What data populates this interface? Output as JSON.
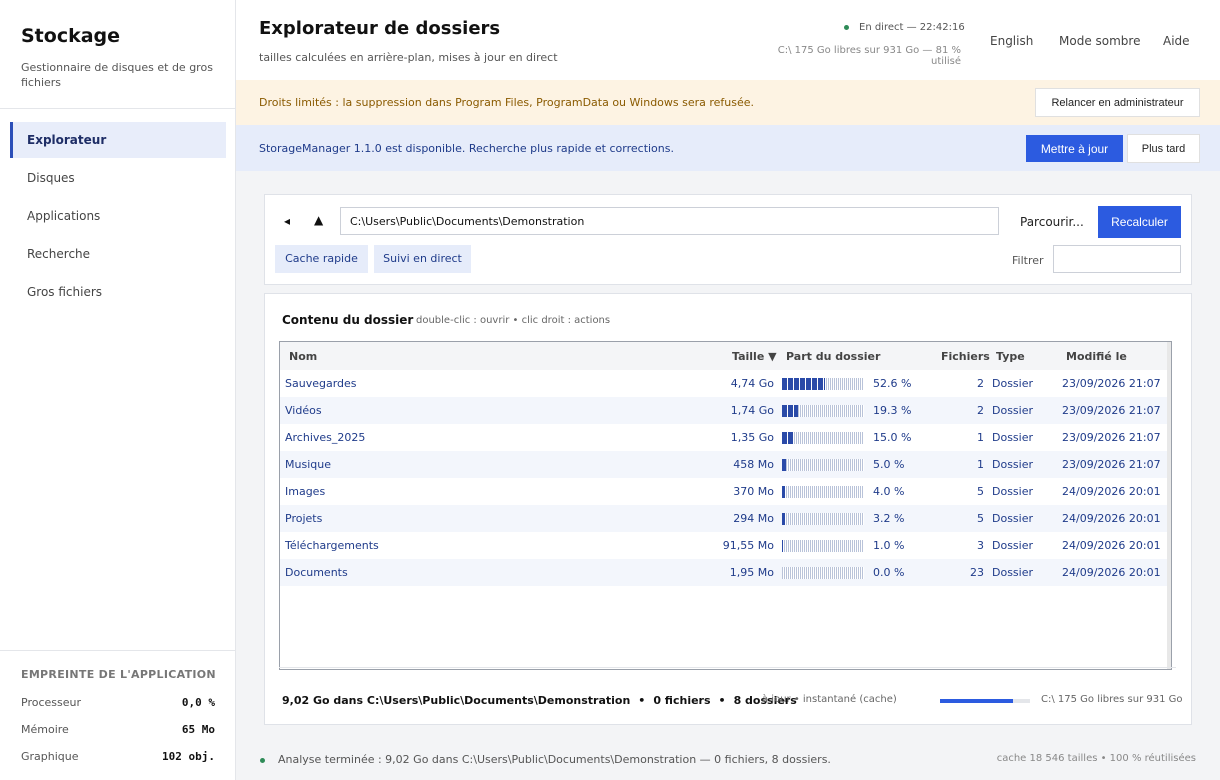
{
  "app": {
    "title": "Stockage",
    "subtitle": "Gestionnaire de disques et de gros fichiers"
  },
  "sidebar": {
    "items": [
      {
        "label": "Explorateur",
        "active": true
      },
      {
        "label": "Disques",
        "active": false
      },
      {
        "label": "Applications",
        "active": false
      },
      {
        "label": "Recherche",
        "active": false
      },
      {
        "label": "Gros fichiers",
        "active": false
      }
    ],
    "footprint": {
      "title": "EMPREINTE DE L'APPLICATION",
      "rows": [
        {
          "label": "Processeur",
          "value": "0,0 %"
        },
        {
          "label": "Mémoire",
          "value": "65 Mo"
        },
        {
          "label": "Graphique",
          "value": "102 obj."
        }
      ]
    }
  },
  "header": {
    "title": "Explorateur de dossiers",
    "subtitle": "tailles calculées en arrière-plan, mises à jour en direct",
    "live": "En direct — 22:42:16",
    "disk": "C:\\ 175 Go libres sur 931 Go — 81 % utilisé",
    "links": [
      "English",
      "Mode sombre",
      "Aide"
    ]
  },
  "warning": {
    "text": "Droits limités : la suppression dans Program Files, ProgramData ou Windows sera refusée.",
    "button": "Relancer en administrateur"
  },
  "update": {
    "text": "StorageManager 1.1.0 est disponible. Recherche plus rapide et corrections.",
    "primary": "Mettre à jour",
    "secondary": "Plus tard"
  },
  "toolbar": {
    "back": "◂",
    "up": "▲",
    "path": "C:\\Users\\Public\\Documents\\Demonstration",
    "browse": "Parcourir...",
    "recalc": "Recalculer",
    "chip_cache": "Cache rapide",
    "chip_live": "Suivi en direct",
    "filter_label": "Filtrer",
    "filter_value": ""
  },
  "contents": {
    "title": "Contenu du dossier",
    "hint": "double-clic : ouvrir • clic droit : actions",
    "columns": {
      "name": "Nom",
      "size": "Taille ▼",
      "share": "Part du dossier",
      "files": "Fichiers",
      "type": "Type",
      "modified": "Modifié le"
    },
    "rows": [
      {
        "name": "Sauvegardes",
        "size": "4,74 Go",
        "pct": "52.6 %",
        "share": 0.526,
        "files": "2",
        "type": "Dossier",
        "modified": "23/09/2026 21:07"
      },
      {
        "name": "Vidéos",
        "size": "1,74 Go",
        "pct": "19.3 %",
        "share": 0.193,
        "files": "2",
        "type": "Dossier",
        "modified": "23/09/2026 21:07"
      },
      {
        "name": "Archives_2025",
        "size": "1,35 Go",
        "pct": "15.0 %",
        "share": 0.15,
        "files": "1",
        "type": "Dossier",
        "modified": "23/09/2026 21:07"
      },
      {
        "name": "Musique",
        "size": "458 Mo",
        "pct": "5.0 %",
        "share": 0.05,
        "files": "1",
        "type": "Dossier",
        "modified": "23/09/2026 21:07"
      },
      {
        "name": "Images",
        "size": "370 Mo",
        "pct": "4.0 %",
        "share": 0.04,
        "files": "5",
        "type": "Dossier",
        "modified": "24/09/2026 20:01"
      },
      {
        "name": "Projets",
        "size": "294 Mo",
        "pct": "3.2 %",
        "share": 0.032,
        "files": "5",
        "type": "Dossier",
        "modified": "24/09/2026 20:01"
      },
      {
        "name": "Téléchargements",
        "size": "91,55 Mo",
        "pct": "1.0 %",
        "share": 0.01,
        "files": "3",
        "type": "Dossier",
        "modified": "24/09/2026 20:01"
      },
      {
        "name": "Documents",
        "size": "1,95 Mo",
        "pct": "0.0 %",
        "share": 0.0,
        "files": "23",
        "type": "Dossier",
        "modified": "24/09/2026 20:01"
      }
    ],
    "summary": {
      "total": "9,02 Go dans C:\\Users\\Public\\Documents\\Demonstration",
      "files": "0 fichiers",
      "folders": "8 dossiers",
      "sep": "•",
      "status": "à jour • instantané (cache)",
      "disk_used": 0.81,
      "free": "C:\\ 175 Go libres sur 931 Go"
    }
  },
  "statusbar": {
    "text": "Analyse terminée : 9,02 Go dans C:\\Users\\Public\\Documents\\Demonstration — 0 fichiers, 8 dossiers.",
    "right": "cache 18 546 tailles • 100 % réutilisées"
  },
  "colors": {
    "accent": "#2c5be0",
    "bar": "#2a4aa8",
    "live": "#2e8b57",
    "warning_bg": "#fdf3e3",
    "info_bg": "#e6ecfa"
  }
}
